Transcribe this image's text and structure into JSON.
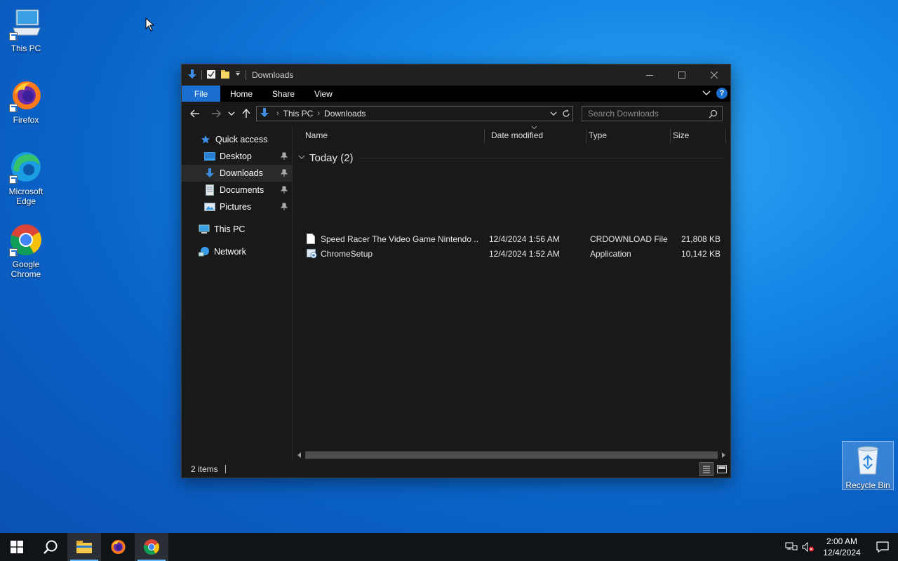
{
  "desktop": {
    "icons": [
      {
        "label": "This PC"
      },
      {
        "label": "Firefox"
      },
      {
        "label": "Microsoft\nEdge"
      },
      {
        "label": "Google\nChrome"
      }
    ],
    "recycle_bin": "Recycle Bin"
  },
  "window": {
    "title": "Downloads",
    "ribbon_tabs": [
      "File",
      "Home",
      "Share",
      "View"
    ],
    "help": "?",
    "address": {
      "crumbs": [
        "This PC",
        "Downloads"
      ]
    },
    "search": {
      "placeholder": "Search Downloads"
    },
    "nav": {
      "quick_access": "Quick access",
      "items": [
        {
          "label": "Desktop",
          "pinned": true
        },
        {
          "label": "Downloads",
          "pinned": true,
          "selected": true
        },
        {
          "label": "Documents",
          "pinned": true
        },
        {
          "label": "Pictures",
          "pinned": true
        }
      ],
      "this_pc": "This PC",
      "network": "Network"
    },
    "columns": {
      "name": "Name",
      "date": "Date modified",
      "type": "Type",
      "size": "Size"
    },
    "group": "Today (2)",
    "files": [
      {
        "name": "Speed Racer The Video Game Nintendo ...",
        "date": "12/4/2024 1:56 AM",
        "type": "CRDOWNLOAD File",
        "size": "21,808 KB",
        "icon": "blank-file-icon"
      },
      {
        "name": "ChromeSetup",
        "date": "12/4/2024 1:52 AM",
        "type": "Application",
        "size": "10,142 KB",
        "icon": "installer-icon"
      }
    ],
    "status": "2 items"
  },
  "taskbar": {
    "time": "2:00 AM",
    "date": "12/4/2024"
  },
  "colors": {
    "accent": "#1a6fd0",
    "window_bg": "#191919",
    "taskbar_bg": "#101418"
  }
}
